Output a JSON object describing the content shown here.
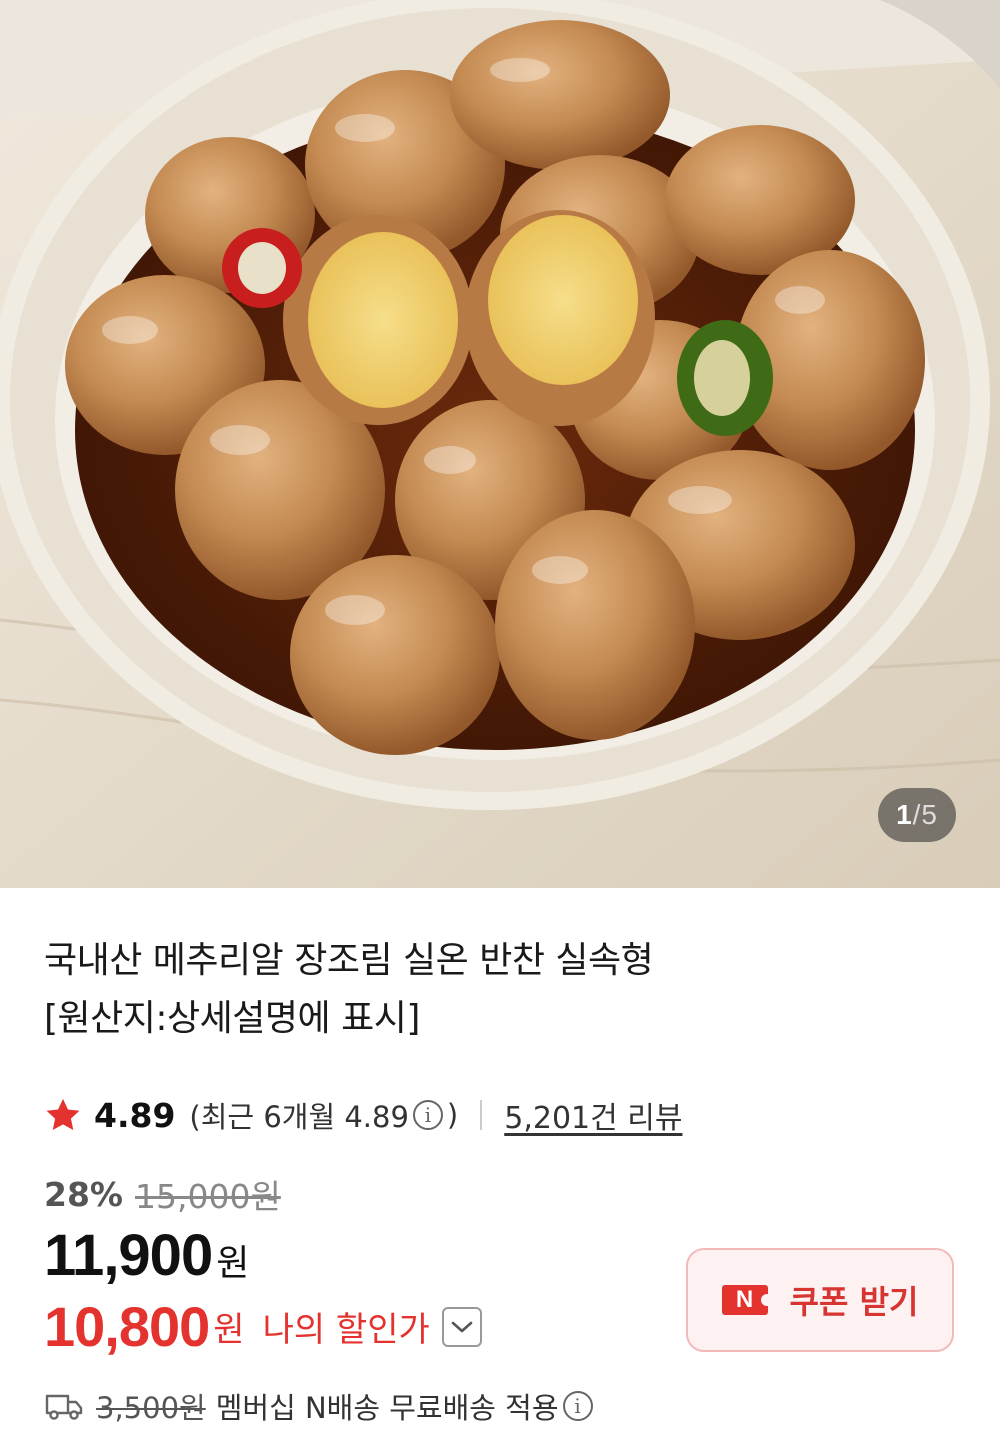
{
  "gallery": {
    "current": "1",
    "separator": "/",
    "total": "5"
  },
  "product": {
    "title_line1": "국내산 메추리알 장조림 실온 반찬 실속형",
    "title_line2": "[원산지:상세설명에 표시]"
  },
  "rating": {
    "score": "4.89",
    "recent_prefix": "(최근 6개월 4.89",
    "recent_suffix": ")",
    "info_icon": "i",
    "review_link": "5,201건 리뷰"
  },
  "pricing": {
    "discount_rate": "28%",
    "original_price": "15,000원",
    "price": "11,900",
    "price_unit": "원",
    "my_price": "10,800",
    "my_price_unit": "원",
    "my_price_label": "나의 할인가"
  },
  "coupon": {
    "badge": "N",
    "label": "쿠폰 받기"
  },
  "shipping": {
    "original_fee": "3,500원",
    "text": "멤버십 N배송 무료배송 적용",
    "info_icon": "i"
  },
  "colors": {
    "accent_red": "#e4322f",
    "star": "#e4322f",
    "coupon_bg": "#fdf1f1"
  },
  "icons": {
    "star": "star-icon",
    "info": "info-icon",
    "chevron": "chevron-down-icon",
    "truck": "truck-icon",
    "coupon_badge": "naver-n-icon"
  }
}
